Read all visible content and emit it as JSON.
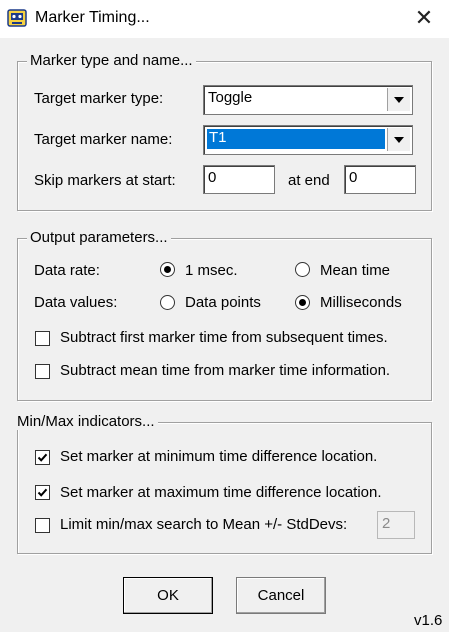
{
  "window": {
    "title": "Marker Timing...",
    "icon": "app-icon",
    "close_icon": "close-icon"
  },
  "marker_group": {
    "title": "Marker type and name...",
    "type_label": "Target marker type:",
    "type_value": "Toggle",
    "name_label": "Target marker name:",
    "name_value": "T1",
    "skip_label": "Skip markers at start:",
    "skip_start_value": "0",
    "at_end_label": "at end",
    "skip_end_value": "0"
  },
  "output_group": {
    "title": "Output parameters...",
    "rate_label": "Data rate:",
    "rate_options": [
      {
        "label": "1 msec.",
        "selected": true
      },
      {
        "label": "Mean time",
        "selected": false
      }
    ],
    "values_label": "Data values:",
    "values_options": [
      {
        "label": "Data points",
        "selected": false
      },
      {
        "label": "Milliseconds",
        "selected": true
      }
    ],
    "subtract_first_label": "Subtract first marker time from subsequent times.",
    "subtract_first_checked": false,
    "subtract_mean_label": "Subtract mean time from marker time information.",
    "subtract_mean_checked": false
  },
  "minmax_group": {
    "title": "Min/Max indicators...",
    "set_min_label": "Set marker at minimum time difference location.",
    "set_min_checked": true,
    "set_max_label": "Set marker at maximum time difference location.",
    "set_max_checked": true,
    "limit_label": "Limit min/max search to Mean +/- StdDevs:",
    "limit_checked": false,
    "stddevs_value": "2"
  },
  "buttons": {
    "ok": "OK",
    "cancel": "Cancel"
  },
  "version": "v1.6"
}
